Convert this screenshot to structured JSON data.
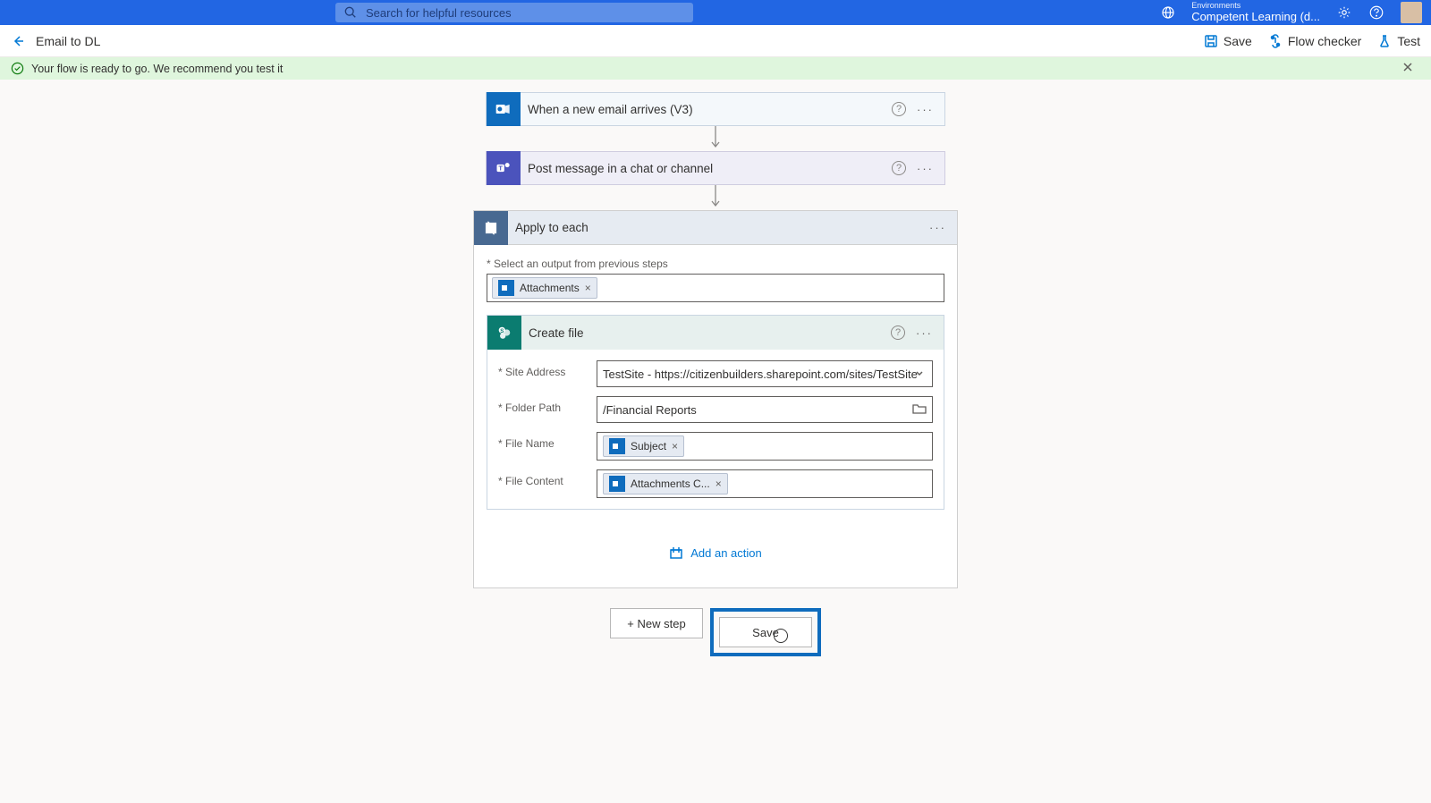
{
  "topbar": {
    "search_placeholder": "Search for helpful resources",
    "env_label": "Environments",
    "env_value": "Competent Learning (d..."
  },
  "cmdbar": {
    "title": "Email to DL",
    "save": "Save",
    "flow_checker": "Flow checker",
    "test": "Test"
  },
  "banner": {
    "message": "Your flow is ready to go. We recommend you test it"
  },
  "steps": {
    "trigger": "When a new email arrives (V3)",
    "post_message": "Post message in a chat or channel",
    "apply": "Apply to each",
    "apply_field_label": "* Select an output from previous steps",
    "attachments_token": "Attachments",
    "create_file": "Create file",
    "add_action": "Add an action"
  },
  "create_file_form": {
    "site_address_label": "* Site Address",
    "site_address_value": "TestSite - https://citizenbuilders.sharepoint.com/sites/TestSite",
    "folder_path_label": "* Folder Path",
    "folder_path_value": "/Financial Reports",
    "file_name_label": "* File Name",
    "file_name_token": "Subject",
    "file_content_label": "* File Content",
    "file_content_token": "Attachments C..."
  },
  "buttons": {
    "new_step": "+ New step",
    "save": "Save"
  }
}
